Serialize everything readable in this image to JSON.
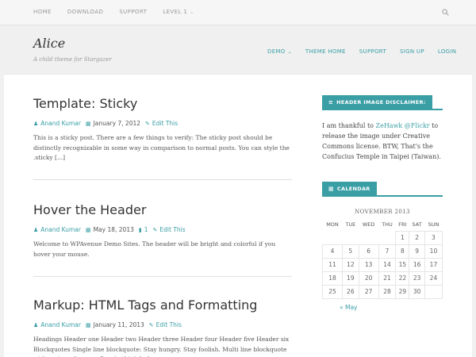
{
  "topbar": {
    "nav": [
      "HOME",
      "DOWNLOAD",
      "SUPPORT",
      "LEVEL 1"
    ],
    "search_icon": "search-icon"
  },
  "header": {
    "site_title": "Alice",
    "site_description": "A child theme for Stargazer",
    "nav": [
      "DEMO",
      "THEME HOME",
      "SUPPORT",
      "SIGN UP",
      "LOGIN"
    ]
  },
  "posts": [
    {
      "title": "Template: Sticky",
      "author": "Anand Kumar",
      "date": "January 7, 2012",
      "comments": "",
      "edit": "Edit This",
      "excerpt": "This is a sticky post. There are a few things to verify: The sticky post should be distinctly recognizable in some way in comparison to normal posts. You can style the .sticky [...]"
    },
    {
      "title": "Hover the Header",
      "author": "Anand Kumar",
      "date": "May 18, 2013",
      "comments": "1",
      "edit": "Edit This",
      "excerpt": "Welcome to WPAvenue Demo Sites. The header will be bright and colorful if you hover your mouse."
    },
    {
      "title": "Markup: HTML Tags and Formatting",
      "author": "Anand Kumar",
      "date": "January 11, 2013",
      "comments": "",
      "edit": "Edit This",
      "excerpt": "Headings Header one Header two Header three Header four Header five Header six Blockquotes Single line blockquote: Stay hungry. Stay foolish. Multi line blockquote with a cite reference: People think [...]"
    }
  ],
  "sidebar": {
    "disclaimer": {
      "title": "HEADER IMAGE DISCLAIMER:",
      "text_before": "I am thankful to ",
      "link": "ZeHawk @Flickr",
      "text_after": " to release the image under Creative Commons license. BTW, That's the Confucius Temple in Taipei (Taiwan)."
    },
    "calendar": {
      "title": "CALENDAR",
      "caption": "NOVEMBER 2013",
      "days": [
        "MON",
        "TUE",
        "WED",
        "THU",
        "FRI",
        "SAT",
        "SUN"
      ],
      "weeks": [
        [
          "",
          "",
          "",
          "",
          "1",
          "2",
          "3"
        ],
        [
          "4",
          "5",
          "6",
          "7",
          "8",
          "9",
          "10"
        ],
        [
          "11",
          "12",
          "13",
          "14",
          "15",
          "16",
          "17"
        ],
        [
          "18",
          "19",
          "20",
          "21",
          "22",
          "23",
          "24"
        ],
        [
          "25",
          "26",
          "27",
          "28",
          "29",
          "30",
          ""
        ]
      ],
      "prev_link": "« May"
    }
  },
  "colors": {
    "accent": "#3a9ea5",
    "title_text": "#333333",
    "body_text": "#555555"
  }
}
